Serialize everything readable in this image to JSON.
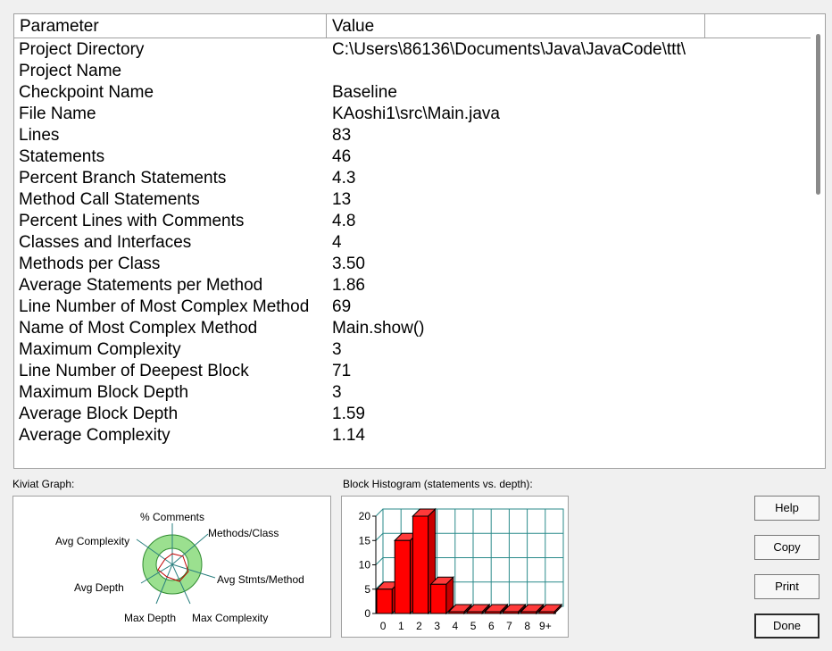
{
  "table": {
    "header_parameter": "Parameter",
    "header_value": "Value",
    "rows": [
      {
        "p": "Project Directory",
        "v": "C:\\Users\\86136\\Documents\\Java\\JavaCode\\ttt\\"
      },
      {
        "p": "Project Name",
        "v": ""
      },
      {
        "p": "Checkpoint Name",
        "v": "Baseline"
      },
      {
        "p": "File Name",
        "v": "KAoshi1\\src\\Main.java"
      },
      {
        "p": "Lines",
        "v": "83"
      },
      {
        "p": "Statements",
        "v": "46"
      },
      {
        "p": "Percent Branch Statements",
        "v": "4.3"
      },
      {
        "p": "Method Call Statements",
        "v": "13"
      },
      {
        "p": "Percent Lines with Comments",
        "v": "4.8"
      },
      {
        "p": "Classes and Interfaces",
        "v": "4"
      },
      {
        "p": "Methods per Class",
        "v": "3.50"
      },
      {
        "p": "Average Statements per Method",
        "v": "1.86"
      },
      {
        "p": "Line Number of Most Complex Method",
        "v": "69"
      },
      {
        "p": "Name of Most Complex Method",
        "v": "Main.show()"
      },
      {
        "p": "Maximum Complexity",
        "v": "3"
      },
      {
        "p": "Line Number of Deepest Block",
        "v": "71"
      },
      {
        "p": "Maximum Block Depth",
        "v": "3"
      },
      {
        "p": "Average Block Depth",
        "v": "1.59"
      },
      {
        "p": "Average Complexity",
        "v": "1.14"
      }
    ]
  },
  "kiviat": {
    "label": "Kiviat Graph:",
    "axes": {
      "comments": "% Comments",
      "methods_class": "Methods/Class",
      "avg_stmts": "Avg Stmts/Method",
      "max_complexity": "Max Complexity",
      "max_depth": "Max Depth",
      "avg_depth": "Avg Depth",
      "avg_complexity": "Avg Complexity"
    },
    "colors": {
      "band": "#9be08f",
      "band_edge": "#2f8a2f",
      "spoke": "#2a7f7f",
      "trace": "#c00000"
    }
  },
  "histogram": {
    "label": "Block Histogram (statements vs. depth):",
    "y_ticks": [
      "0",
      "5",
      "10",
      "15",
      "20"
    ],
    "x_ticks": [
      "0",
      "1",
      "2",
      "3",
      "4",
      "5",
      "6",
      "7",
      "8",
      "9+"
    ],
    "colors": {
      "bar": "#ff0000",
      "grid": "#2a8a8a"
    }
  },
  "chart_data": {
    "type": "bar",
    "title": "Block Histogram (statements vs. depth):",
    "categories": [
      "0",
      "1",
      "2",
      "3",
      "4",
      "5",
      "6",
      "7",
      "8",
      "9+"
    ],
    "values": [
      5,
      15,
      20,
      6,
      0,
      0,
      0,
      0,
      0,
      0
    ],
    "ylim": [
      0,
      20
    ],
    "grid": true
  },
  "buttons": {
    "help": "Help",
    "copy": "Copy",
    "print": "Print",
    "done": "Done"
  }
}
